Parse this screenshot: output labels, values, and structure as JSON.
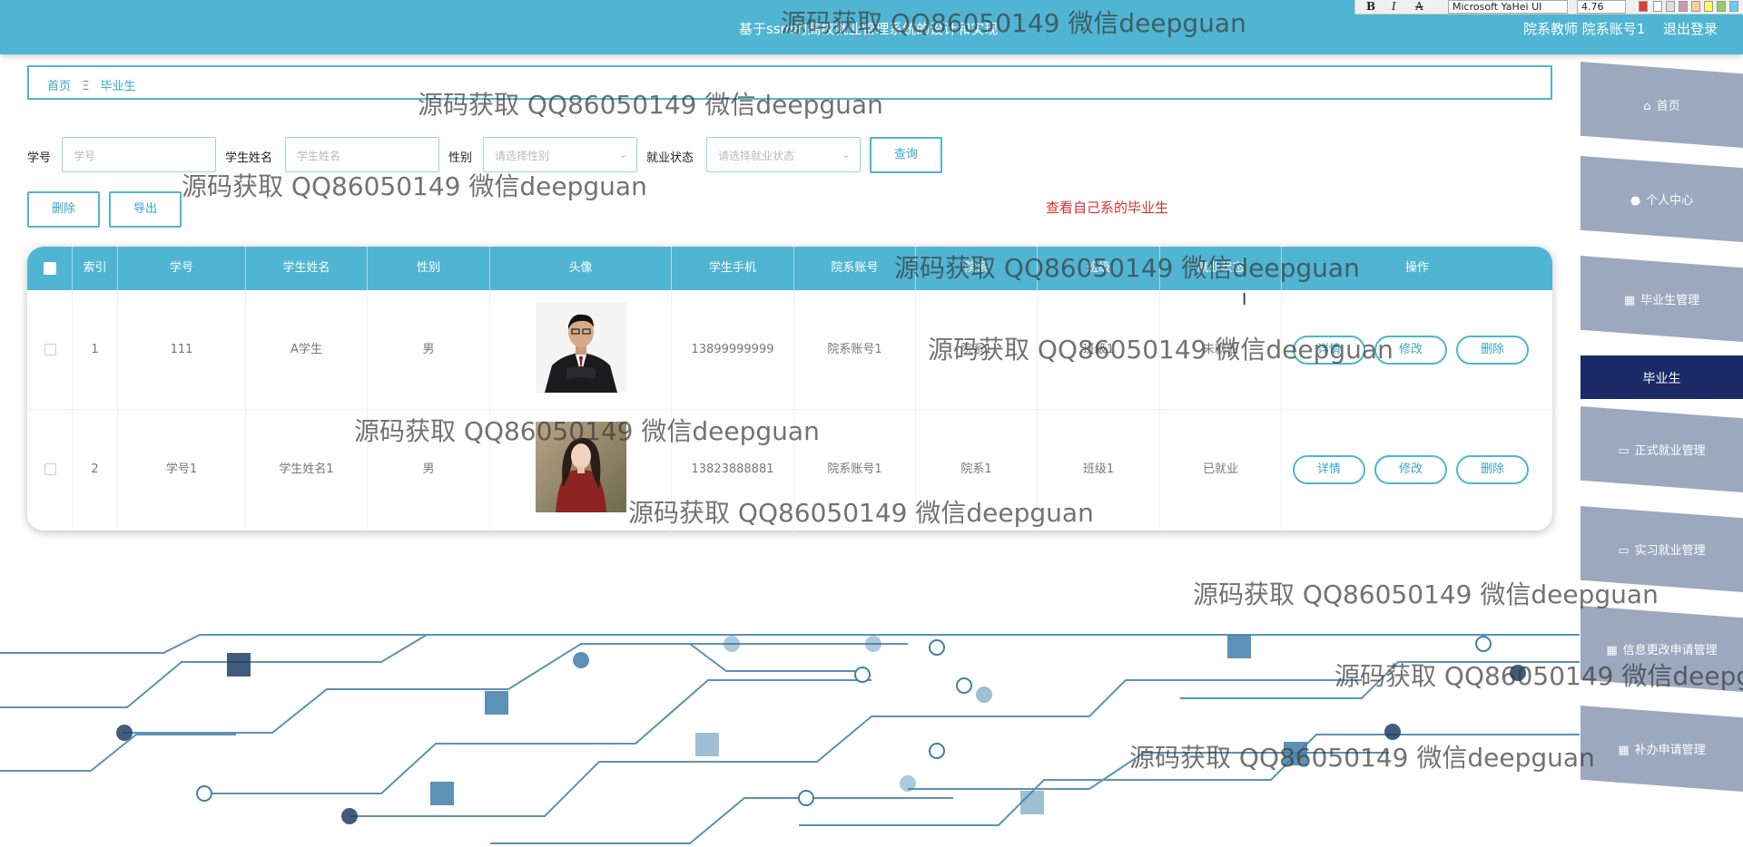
{
  "header": {
    "title": "基于ssm的高校就业管理系统的设计和实现",
    "user_text": "院系教师 院系账号1",
    "logout": "退出登录"
  },
  "editor_toolbar": {
    "bold": "B",
    "italic": "I",
    "strike": "A",
    "font": "Microsoft YaHei UI",
    "size": "4.76",
    "accent_color": "#e53935"
  },
  "breadcrumb": {
    "home": "首页",
    "separator": "Ξ",
    "current": "毕业生"
  },
  "search": {
    "student_id_label": "学号",
    "student_id_placeholder": "学号",
    "name_label": "学生姓名",
    "name_placeholder": "学生姓名",
    "gender_label": "性别",
    "gender_placeholder": "请选择性别",
    "status_label": "就业状态",
    "status_placeholder": "请选择就业状态",
    "query_button": "查询"
  },
  "actions": {
    "delete_button": "删除",
    "export_button": "导出"
  },
  "notice": "查看自己系的毕业生",
  "table": {
    "headers": [
      "索引",
      "学号",
      "学生姓名",
      "性别",
      "头像",
      "学生手机",
      "院系账号",
      "院系",
      "班级",
      "就业状态",
      "操作"
    ],
    "rows": [
      {
        "index": "1",
        "student_id": "111",
        "name": "A学生",
        "gender": "男",
        "phone": "13899999999",
        "dept_account": "院系账号1",
        "dept": "院系1",
        "class": "班级1",
        "status": "未就业",
        "avatar_icon": "man-portrait-photo"
      },
      {
        "index": "2",
        "student_id": "学号1",
        "name": "学生姓名1",
        "gender": "男",
        "phone": "13823888881",
        "dept_account": "院系账号1",
        "dept": "院系1",
        "class": "班级1",
        "status": "已就业",
        "avatar_icon": "woman-portrait-photo"
      }
    ],
    "row_actions": {
      "detail": "详情",
      "edit": "修改",
      "delete": "删除"
    }
  },
  "menu": {
    "items": [
      {
        "label": "首页",
        "icon": "home-icon"
      },
      {
        "label": "个人中心",
        "icon": "user-icon"
      },
      {
        "label": "毕业生管理",
        "icon": "grid-icon"
      },
      {
        "label": "毕业生",
        "icon": "",
        "active": true
      },
      {
        "label": "正式就业管理",
        "icon": "monitor-icon"
      },
      {
        "label": "实习就业管理",
        "icon": "monitor-icon"
      },
      {
        "label": "信息更改申请管理",
        "icon": "grid-icon"
      },
      {
        "label": "补办申请管理",
        "icon": "grid-icon"
      }
    ]
  },
  "watermark": "源码获取 QQ86050149 微信deepguan",
  "colors": {
    "primary": "#4fb5d2",
    "menu_bg": "#9ba8be",
    "menu_active": "#1a2a66",
    "notice": "#d32f2f"
  }
}
